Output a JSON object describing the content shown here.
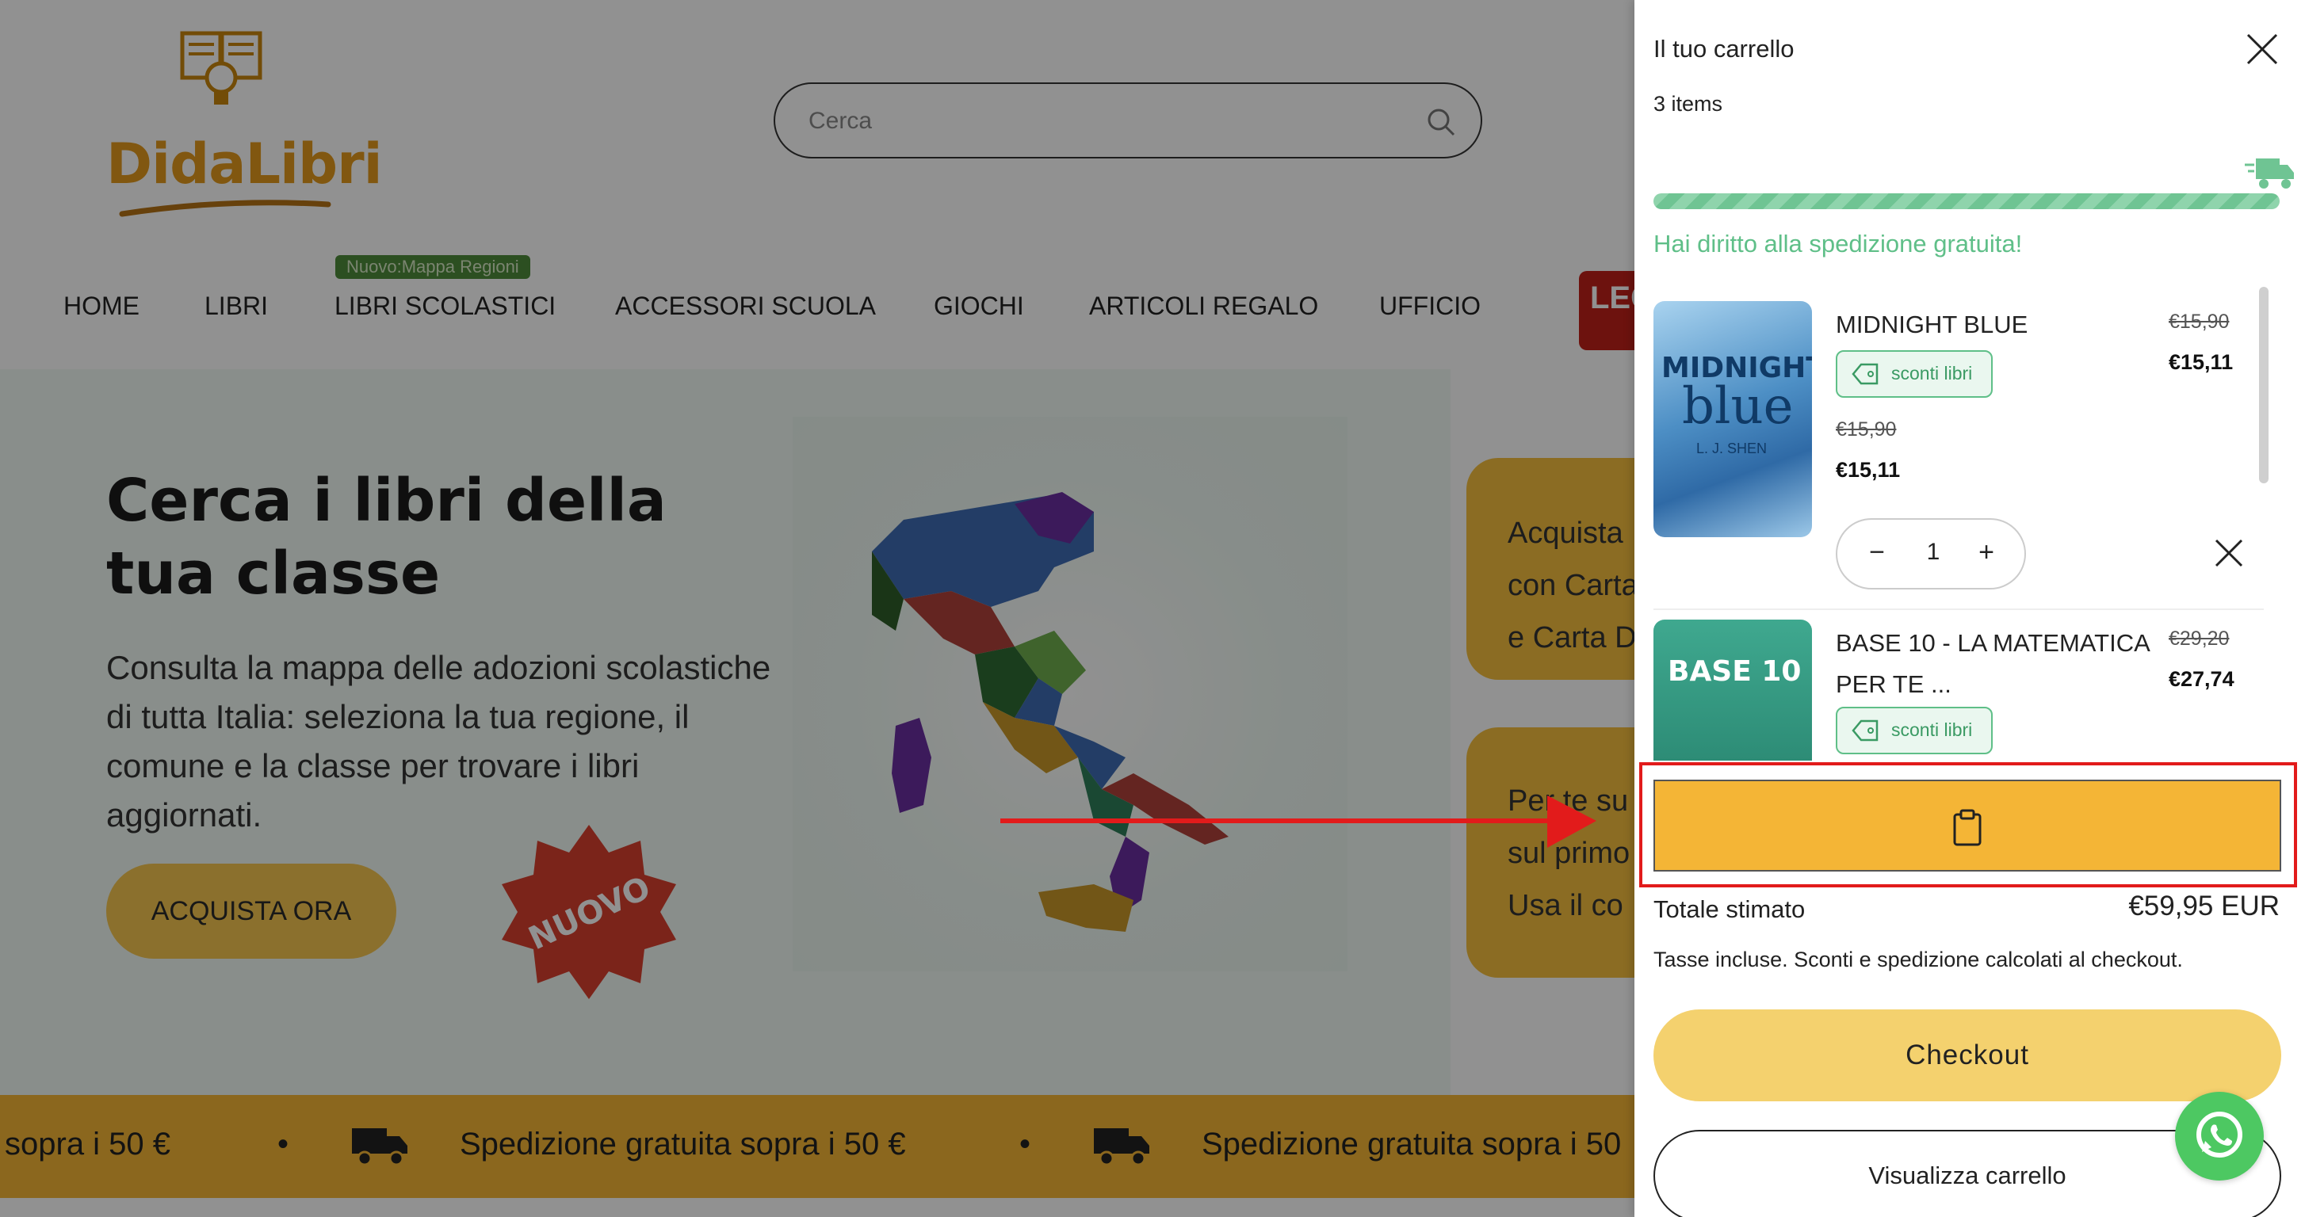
{
  "header": {
    "logo_text": "DidaLibri",
    "search_placeholder": "Cerca"
  },
  "nav": {
    "badge": "Nuovo:Mappa Regioni",
    "items": [
      "HOME",
      "LIBRI",
      "LIBRI SCOLASTICI",
      "ACCESSORI SCUOLA",
      "GIOCHI",
      "ARTICOLI REGALO",
      "UFFICIO"
    ],
    "lego_label": "LEG"
  },
  "hero": {
    "title": "Cerca i libri della tua classe",
    "description": "Consulta la mappa delle adozioni scolastiche di tutta Italia: seleziona la tua regione, il comune e la classe per trovare i libri aggiornati.",
    "cta": "ACQUISTA ORA",
    "badge": "NUOVO"
  },
  "side_cards": {
    "card1": [
      "Acquista",
      "con Carta",
      "e Carta D"
    ],
    "card2": [
      "Per te su",
      "sul primo",
      "Usa il co"
    ]
  },
  "ticker": {
    "text1": "sopra i 50 €",
    "text2": "Spedizione gratuita sopra i 50 €",
    "text3": "Spedizione gratuita sopra i 50",
    "dot": "•"
  },
  "cart": {
    "title": "Il tuo carrello",
    "count": "3 items",
    "shipping_message": "Hai diritto alla spedizione gratuita!",
    "shipping_progress": 1.0,
    "items": [
      {
        "name": "MIDNIGHT BLUE",
        "cover_title_1": "MIDNIGHT",
        "cover_title_2": "blue",
        "cover_author": "L. J. SHEN",
        "badge": "sconti libri",
        "old_price": "€15,90",
        "new_price": "€15,11",
        "unit_old_price": "€15,90",
        "unit_new_price": "€15,11",
        "quantity": "1"
      },
      {
        "name": "BASE 10 - LA MATEMATICA PER TE ...",
        "cover_title": "BASE 10",
        "badge": "sconti libri",
        "old_price": "€29,20",
        "new_price": "€27,74"
      }
    ],
    "minus": "−",
    "plus": "+",
    "total_label": "Totale stimato",
    "total_value": "€59,95 EUR",
    "tax_note": "Tasse incluse. Sconti e spedizione calcolati al checkout.",
    "checkout": "Checkout",
    "view_cart": "Visualizza carrello"
  },
  "colors": {
    "accent_yellow": "#f4b536",
    "checkout_yellow": "#f4d16e",
    "success_green": "#5fbf88",
    "highlight_red": "#e21b1b",
    "whatsapp_green": "#4dc862"
  }
}
